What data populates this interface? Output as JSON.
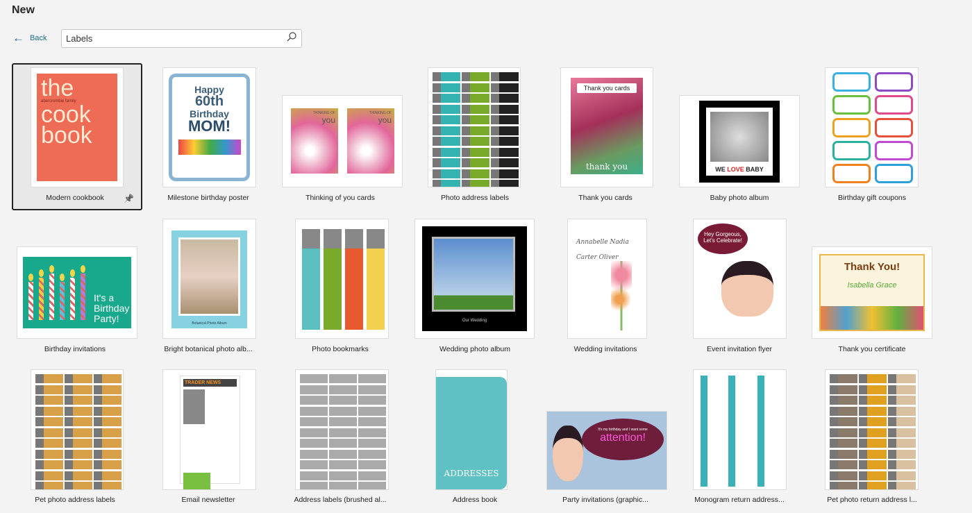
{
  "header": {
    "title": "New",
    "back_label": "Back",
    "back_icon": "arrow-left-icon"
  },
  "search": {
    "value": "Labels",
    "icon": "search-icon"
  },
  "colors": {
    "accent": "#1f6f8b",
    "selected_border": "#222222"
  },
  "templates": [
    {
      "label": "Modern cookbook",
      "art": "cookbook",
      "selected": true,
      "pinned_icon": "pin-icon",
      "art_text": [
        "the",
        "abercrombie family",
        "cook",
        "book"
      ]
    },
    {
      "label": "Milestone birthday poster",
      "art": "poster",
      "art_text": [
        "Happy",
        "60th",
        "Birthday",
        "MOM!"
      ]
    },
    {
      "label": "Thinking of you cards",
      "art": "thinking",
      "art_text": [
        "THINKING OF",
        "you"
      ]
    },
    {
      "label": "Photo address labels",
      "art": "photolabels"
    },
    {
      "label": "Thank you cards",
      "art": "thankyou",
      "art_text": [
        "Thank you cards",
        "thank you"
      ]
    },
    {
      "label": "Baby photo album",
      "art": "baby",
      "art_text": [
        "WE",
        "LOVE",
        "BABY"
      ]
    },
    {
      "label": "Birthday gift coupons",
      "art": "coupons"
    },
    {
      "label": "Birthday invitations",
      "art": "candles",
      "art_text": [
        "It's a",
        "Birthday",
        "Party!"
      ]
    },
    {
      "label": "Bright botanical photo alb...",
      "art": "botanical",
      "art_text": [
        "Botanical Photo Album"
      ]
    },
    {
      "label": "Photo bookmarks",
      "art": "bookmarks"
    },
    {
      "label": "Wedding photo album",
      "art": "wedding",
      "art_text": [
        "Our Wedding"
      ]
    },
    {
      "label": "Wedding invitations",
      "art": "weddinginv",
      "art_text": [
        "Annabelle Nadia",
        "Carter Oliver"
      ]
    },
    {
      "label": "Event invitation flyer",
      "art": "flyer",
      "art_text": [
        "Hey Gorgeous,",
        "Let's Celebrate!"
      ]
    },
    {
      "label": "Thank you certificate",
      "art": "certificate",
      "art_text": [
        "Thank You!",
        "Isabella Grace"
      ]
    },
    {
      "label": "Pet photo address labels",
      "art": "petlabels"
    },
    {
      "label": "Email newsletter",
      "art": "newsletter",
      "art_text": [
        "TRADER NEWS"
      ]
    },
    {
      "label": "Address labels (brushed al...",
      "art": "brushed"
    },
    {
      "label": "Address book",
      "art": "addressbook",
      "art_text": [
        "ADDRESSES"
      ]
    },
    {
      "label": "Party invitations (graphic...",
      "art": "party",
      "art_text": [
        "It's my birthday and I want some",
        "attention!"
      ]
    },
    {
      "label": "Monogram return address...",
      "art": "monogram"
    },
    {
      "label": "Pet photo return address l...",
      "art": "petreturn"
    }
  ]
}
